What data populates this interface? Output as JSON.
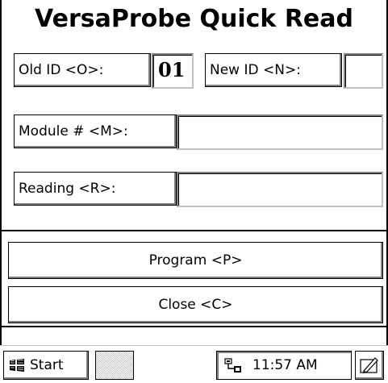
{
  "app": {
    "title": "VersaProbe Quick Read",
    "old_id": {
      "label": "Old ID <O>:",
      "value": "01"
    },
    "new_id": {
      "label": "New ID <N>:",
      "value": ""
    },
    "module": {
      "label": "Module # <M>:",
      "value": ""
    },
    "reading": {
      "label": "Reading <R>:",
      "value": ""
    },
    "program_button": "Program <P>",
    "close_button": "Close <C>"
  },
  "taskbar": {
    "start_label": "Start",
    "clock": "11:57 AM",
    "icons": [
      "windows-flag-icon",
      "network-connection-icon",
      "input-panel-icon"
    ]
  }
}
